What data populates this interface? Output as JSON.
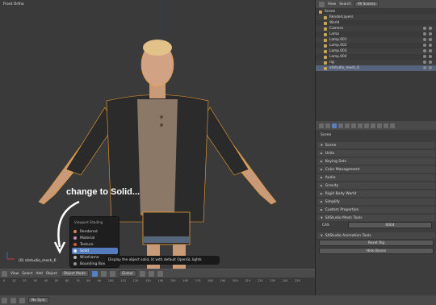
{
  "viewport": {
    "title": "Front Ortho",
    "object_label": "(0) s4studio_mesh_6"
  },
  "annotation": {
    "text": "change to Solid..."
  },
  "shading_menu": {
    "title": "Viewport Shading",
    "items": [
      {
        "label": "Rendered",
        "icon": "rendered-sphere-icon",
        "color": "#d9875c"
      },
      {
        "label": "Material",
        "icon": "material-sphere-icon",
        "color": "#c98fc0"
      },
      {
        "label": "Texture",
        "icon": "texture-icon",
        "color": "#d06040"
      },
      {
        "label": "Solid",
        "icon": "solid-sphere-icon",
        "color": "#f2f2f2",
        "selected": true
      },
      {
        "label": "Wireframe",
        "icon": "wireframe-icon",
        "color": "#bbbbbb"
      },
      {
        "label": "Bounding Box",
        "icon": "bounding-box-icon",
        "color": "#999999"
      }
    ],
    "tooltip": "Display the object solid, lit with default OpenGL lights"
  },
  "vp_header": {
    "view": "View",
    "select": "Select",
    "add": "Add",
    "object": "Object",
    "mode": "Object Mode",
    "pivot": "Global"
  },
  "timeline": {
    "ticks": [
      "0",
      "10",
      "20",
      "30",
      "40",
      "50",
      "60",
      "70",
      "80",
      "90",
      "100",
      "110",
      "120",
      "130",
      "140",
      "150",
      "160",
      "170",
      "180",
      "190",
      "200",
      "210",
      "220",
      "230",
      "240",
      "250"
    ],
    "sync": "No Sync"
  },
  "outliner": {
    "view": "View",
    "search": "Search",
    "scope": "All Scenes",
    "items": [
      {
        "label": "Scene",
        "indent": 0
      },
      {
        "label": "RenderLayers",
        "indent": 1
      },
      {
        "label": "World",
        "indent": 1
      },
      {
        "label": "Camera",
        "indent": 1
      },
      {
        "label": "Lamp",
        "indent": 1
      },
      {
        "label": "Lamp.001",
        "indent": 1
      },
      {
        "label": "Lamp.002",
        "indent": 1
      },
      {
        "label": "Lamp.003",
        "indent": 1
      },
      {
        "label": "Lamp.004",
        "indent": 1
      },
      {
        "label": "rig",
        "indent": 1
      },
      {
        "label": "s4studio_mesh_6",
        "indent": 1,
        "selected": true
      }
    ]
  },
  "properties": {
    "context": "Scene",
    "panels": [
      "Scene",
      "Units",
      "Keying Sets",
      "Color Management",
      "Audio",
      "Gravity",
      "Rigid Body World",
      "Simplify",
      "Custom Properties"
    ],
    "mesh_tools": {
      "header": "S4Studio Mesh Tools",
      "cas_label": "CAS",
      "cas_value": "0004"
    },
    "anim_tools": {
      "header": "S4Studio Animation Tools",
      "reset_rig": "Reset Rig",
      "hide_bones": "Hide Bones"
    }
  }
}
